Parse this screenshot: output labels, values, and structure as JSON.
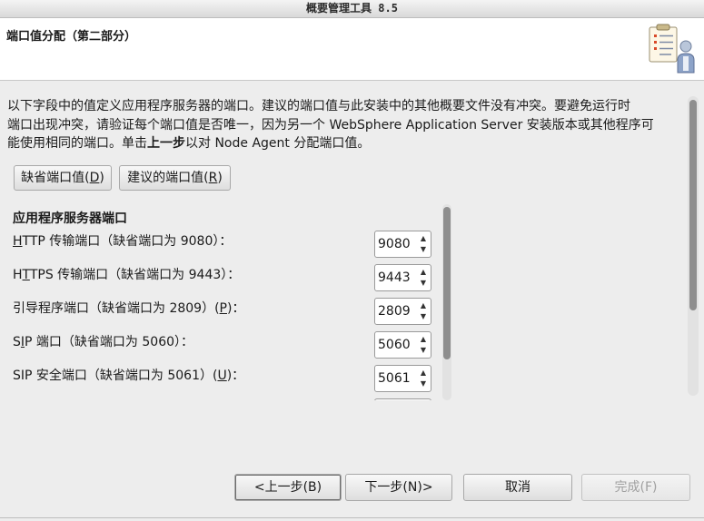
{
  "window": {
    "title": "概要管理工具 8.5"
  },
  "header": {
    "title": "端口值分配（第二部分）",
    "icon": "wizard-clipboard-user-icon"
  },
  "description": {
    "line1": "以下字段中的值定义应用程序服务器的端口。建议的端口值与此安装中的其他概要文件没有冲突。要避免运行时",
    "line2": "端口出现冲突，请验证每个端口值是否唯一，因为另一个 WebSphere Application Server 安装版本或其他程序可",
    "line3_pre": "能使用相同的端口。单击",
    "line3_bold": "上一步",
    "line3_post": "以对 Node Agent 分配端口值。"
  },
  "buttons": {
    "default_ports": {
      "text": "缺省端口值(",
      "key": "D",
      "end": ")"
    },
    "suggested_ports": {
      "text": "建议的端口值(",
      "key": "R",
      "end": ")"
    }
  },
  "section": {
    "title": "应用程序服务器端口"
  },
  "ports": [
    {
      "pre": "",
      "key": "H",
      "post": "TTP 传输端口（缺省端口为 9080）：",
      "value": "9080"
    },
    {
      "pre": "H",
      "key": "T",
      "post": "TPS 传输端口（缺省端口为 9443）：",
      "value": "9443"
    },
    {
      "pre": "引导程序端口（缺省端口为 2809）(",
      "key": "P",
      "post": ")：",
      "value": "2809"
    },
    {
      "pre": "S",
      "key": "I",
      "post": "P 端口（缺省端口为 5060）：",
      "value": "5060"
    },
    {
      "pre": "SIP 安全端口（缺省端口为 5061）(",
      "key": "U",
      "post": ")：",
      "value": "5061"
    }
  ],
  "nav": {
    "back": "<上一步(B)",
    "next": "下一步(N)>",
    "cancel": "取消",
    "finish": "完成(F)"
  }
}
